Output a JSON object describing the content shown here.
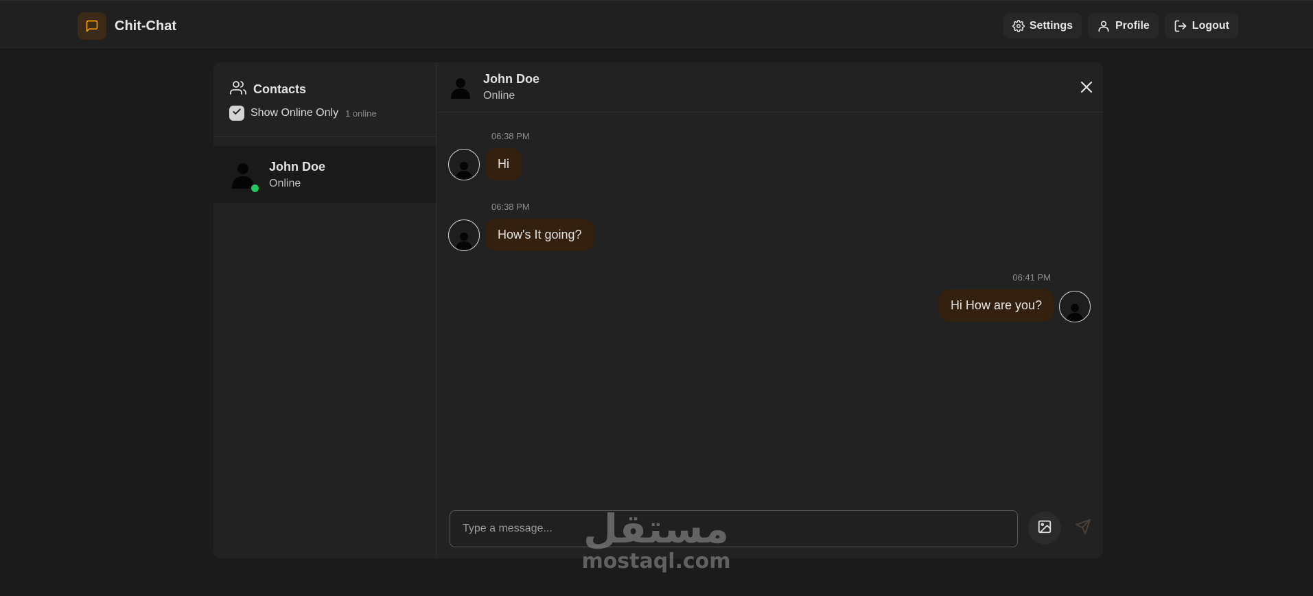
{
  "app": {
    "name": "Chit-Chat",
    "accent_color": "#f59e0b",
    "logo_icon": "message-square-icon"
  },
  "nav": {
    "settings_label": "Settings",
    "profile_label": "Profile",
    "logout_label": "Logout"
  },
  "sidebar": {
    "title": "Contacts",
    "filter_label": "Show Online Only",
    "filter_checked": true,
    "online_count": "1 online",
    "contacts": [
      {
        "name": "John Doe",
        "status": "Online",
        "online": true
      }
    ]
  },
  "chat": {
    "contact_name": "John Doe",
    "contact_status": "Online",
    "messages": [
      {
        "time": "06:38 PM",
        "text": "Hi",
        "side": "received"
      },
      {
        "time": "06:38 PM",
        "text": "How's It going?",
        "side": "received"
      },
      {
        "time": "06:41 PM",
        "text": "Hi How are you?",
        "side": "sent"
      }
    ],
    "input_placeholder": "Type a message..."
  },
  "watermark": {
    "arabic": "مستقل",
    "latin": "mostaql.com"
  }
}
